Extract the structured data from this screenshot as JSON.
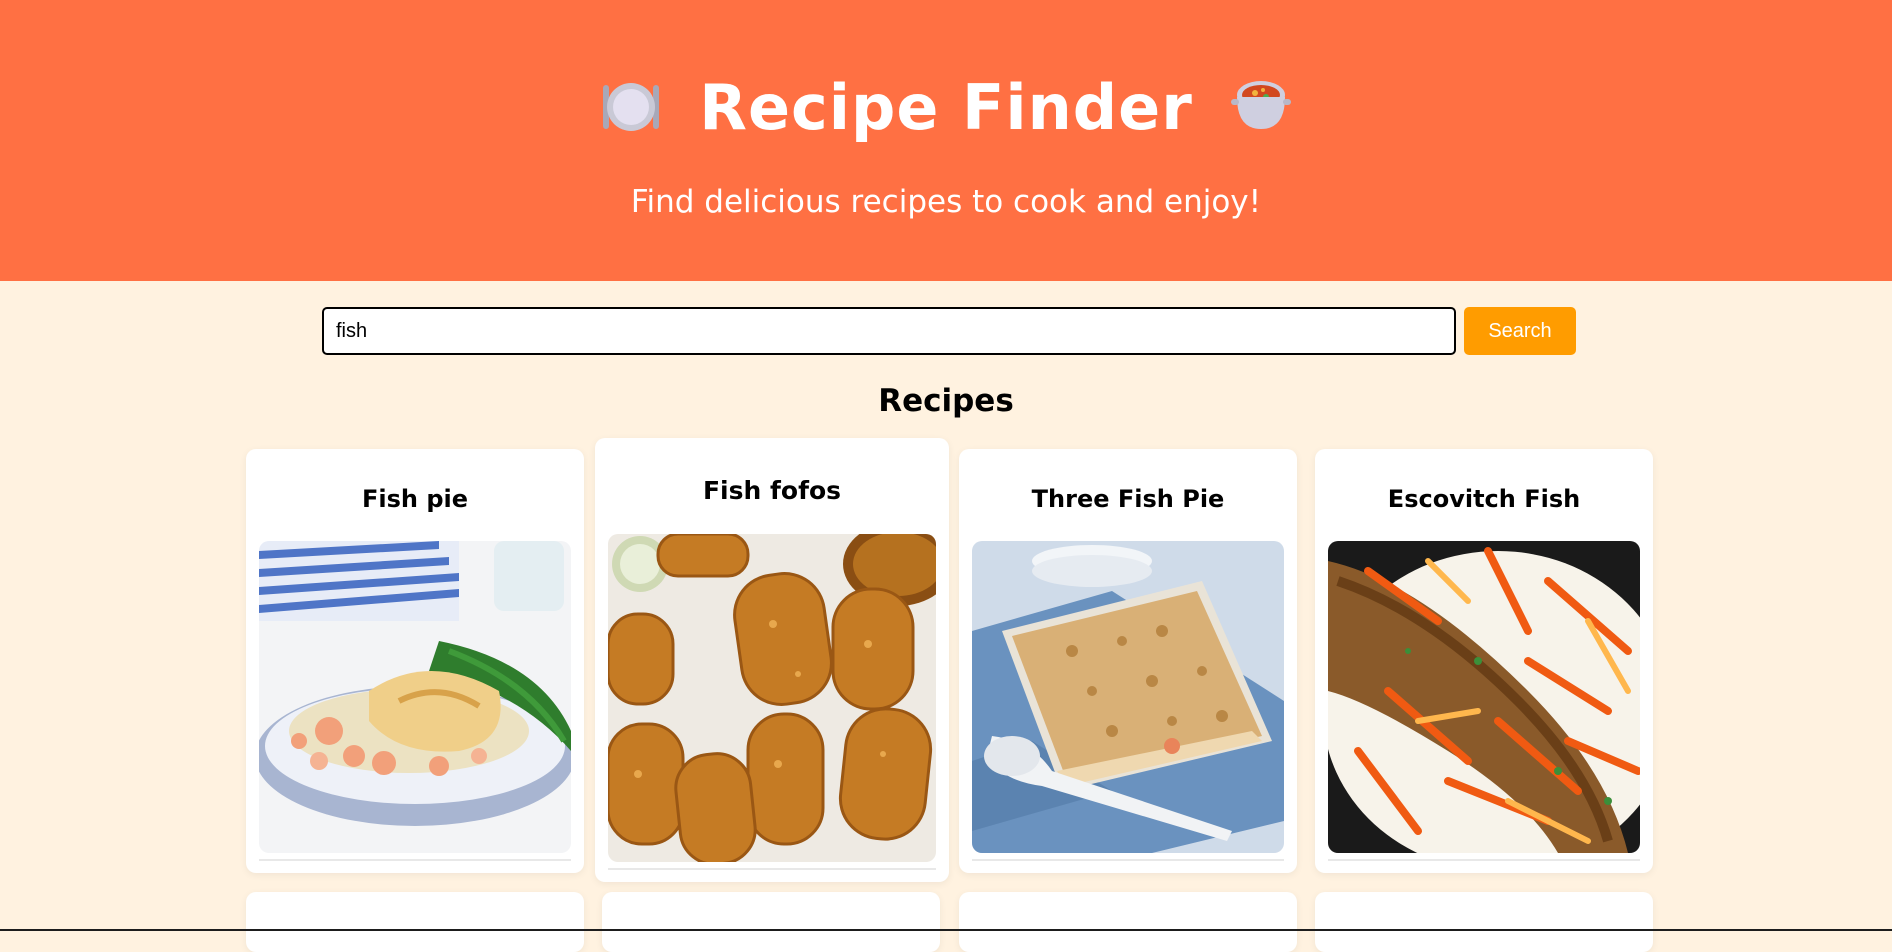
{
  "header": {
    "title": "Recipe Finder",
    "subtitle": "Find delicious recipes to cook and enjoy!",
    "left_icon": "plate-utensils-icon",
    "right_icon": "stew-pot-icon"
  },
  "search": {
    "value": "fish",
    "placeholder": "",
    "button_label": "Search"
  },
  "section_title": "Recipes",
  "recipes": [
    {
      "title": "Fish pie",
      "image": "fish-pie-image"
    },
    {
      "title": "Fish fofos",
      "image": "fish-fofos-image"
    },
    {
      "title": "Three Fish Pie",
      "image": "three-fish-pie-image"
    },
    {
      "title": "Escovitch Fish",
      "image": "escovitch-fish-image"
    }
  ],
  "colors": {
    "header_bg": "#ff7043",
    "page_bg": "#fff2e0",
    "button_bg": "#ff9c00"
  }
}
